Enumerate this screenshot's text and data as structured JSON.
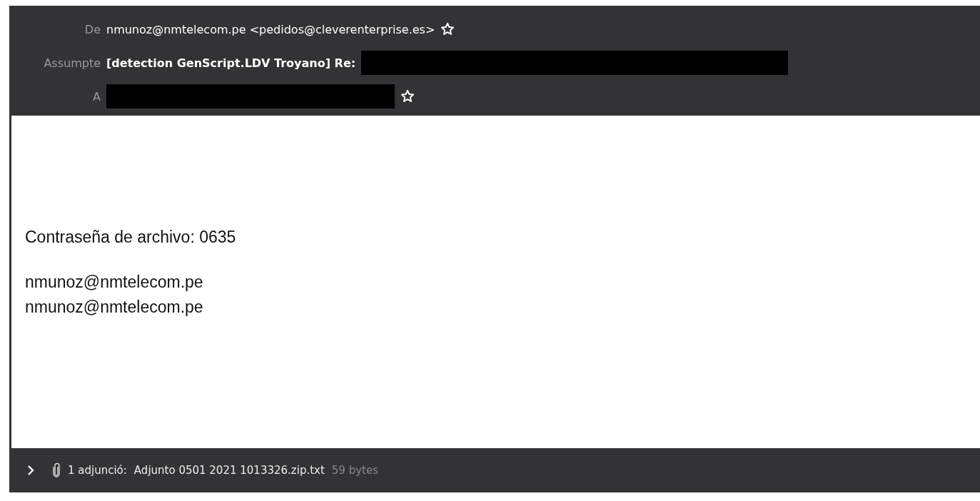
{
  "header": [
    {
      "kind": "address",
      "label": "De",
      "value": "nmunoz@nmtelecom.pe <pedidos@cleverenterprise.es>",
      "redacted": false
    },
    {
      "kind": "subject",
      "label": "Assumpte",
      "value": "[detection GenScript.LDV Troyano] Re:",
      "redacted": true
    },
    {
      "kind": "address",
      "label": "A",
      "redacted": true
    }
  ],
  "body": {
    "paragraphs": [
      [
        "Contraseña de archivo: 0635"
      ],
      [
        "nmunoz@nmtelecom.pe",
        "nmunoz@nmtelecom.pe"
      ]
    ]
  },
  "attachments": {
    "expanded": false,
    "summary": "1 adjunció:",
    "name": "Adjunto 0501 2021 1013326.zip.txt",
    "size": "59 bytes"
  }
}
